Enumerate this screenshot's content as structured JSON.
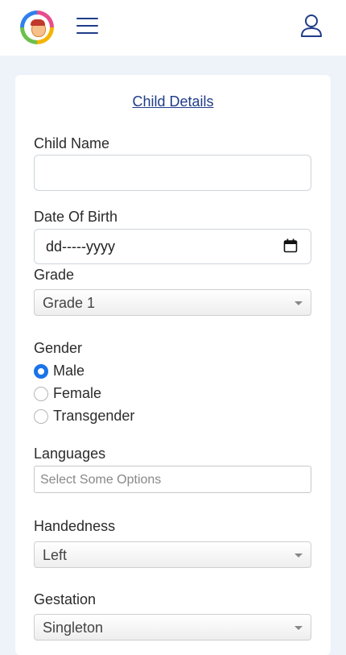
{
  "header": {
    "logo_icon": "child-logo-icon",
    "menu_icon": "hamburger-menu-icon",
    "profile_icon": "user-icon",
    "accent_color": "#1f3c88"
  },
  "form": {
    "title": "Child Details",
    "child_name_label": "Child Name",
    "child_name_value": "",
    "dob_label": "Date Of Birth",
    "dob_placeholder": "dd-----yyyy",
    "grade_label": "Grade",
    "grade_value": "Grade 1",
    "gender_label": "Gender",
    "gender_options": [
      "Male",
      "Female",
      "Transgender"
    ],
    "gender_selected": "Male",
    "languages_label": "Languages",
    "languages_placeholder": "Select Some Options",
    "handedness_label": "Handedness",
    "handedness_value": "Left",
    "gestation_label": "Gestation",
    "gestation_value": "Singleton"
  }
}
